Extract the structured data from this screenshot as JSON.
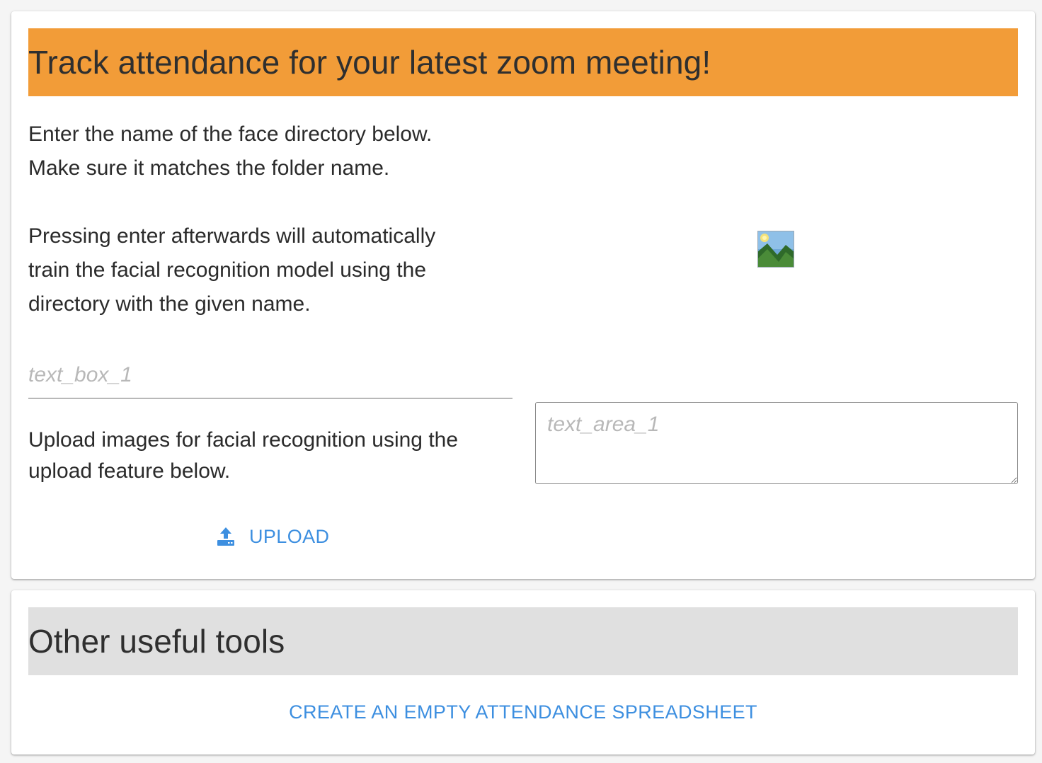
{
  "attendance_card": {
    "title": "Track attendance for your latest zoom meeting!",
    "directory_instructions": [
      "Enter the name of the face directory below.",
      "Make sure it matches the folder name."
    ],
    "training_instructions": [
      "Pressing enter afterwards will automatically",
      "train the facial recognition model using the",
      "directory with the given name."
    ],
    "text_box": {
      "placeholder": "text_box_1",
      "value": ""
    },
    "upload_instructions": [
      "Upload images for facial recognition using the",
      "upload feature below."
    ],
    "text_area": {
      "placeholder": "text_area_1",
      "value": ""
    },
    "image_placeholder_icon": "image-icon",
    "upload_button": {
      "label": "UPLOAD",
      "icon": "upload-icon"
    },
    "header_color": "#f29c38"
  },
  "tools_card": {
    "title": "Other useful tools",
    "create_spreadsheet_button": {
      "label": "CREATE AN EMPTY ATTENDANCE SPREADSHEET"
    },
    "header_color": "#e0e0e0"
  },
  "accent_color": "#3d8fe0"
}
